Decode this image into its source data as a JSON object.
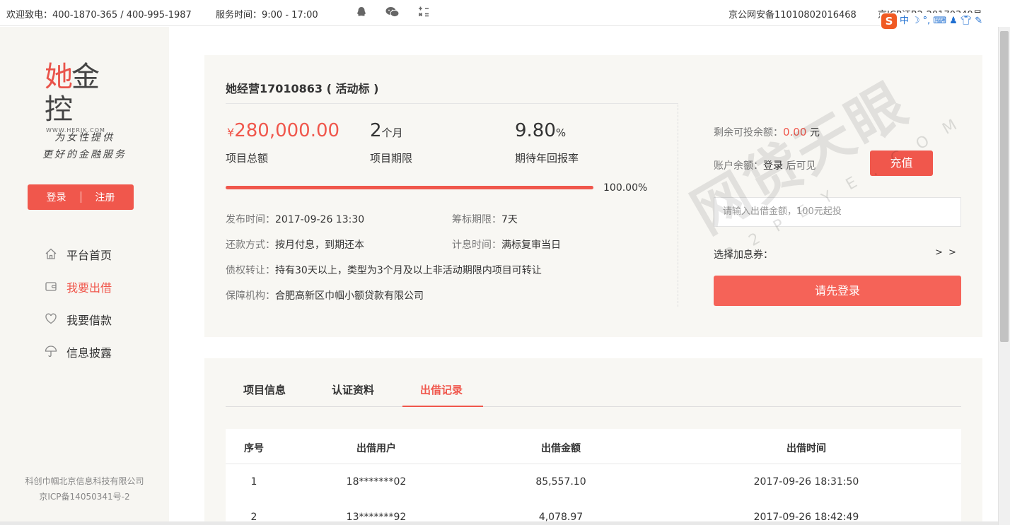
{
  "topbar": {
    "hotline": "欢迎致电：400-1870-365 / 400-995-1987",
    "service_time": "服务时间：9:00 - 17:00",
    "icons": [
      "qq-icon",
      "wechat-icon",
      "calculator-icon"
    ],
    "police_record": "京公网安备11010802016468",
    "icp": "京ICP证B2-20170349号",
    "ime": {
      "logo": "S",
      "lang": "中"
    }
  },
  "sidebar": {
    "logo_cn_red": "她",
    "logo_cn": "金控",
    "logo_url": "WWW.HERJK.COM",
    "slogan_1": "为女性提供",
    "slogan_2": "更好的金融服务",
    "login": "登录",
    "register": "注册",
    "nav": [
      {
        "label": "平台首页",
        "icon": "home-icon"
      },
      {
        "label": "我要出借",
        "icon": "wallet-icon",
        "active": true
      },
      {
        "label": "我要借款",
        "icon": "heart-icon"
      },
      {
        "label": "信息披露",
        "icon": "umbrella-icon"
      }
    ],
    "footer_1": "科创巾帼北京信息科技有限公司",
    "footer_2": "京ICP备14050341号-2"
  },
  "project": {
    "title": "她经营17010863 ( 活动标 )",
    "currency_symbol": "¥",
    "total_amount": "280,000.00",
    "total_label": "项目总额",
    "term_value": "2",
    "term_unit": "个月",
    "term_label": "项目期限",
    "rate_value": "9.80",
    "rate_unit": "%",
    "rate_label": "期待年回报率",
    "progress_percent": 100,
    "progress_text": "100.00%",
    "publish_key": "发布时间：",
    "publish_val": "2017-09-26 13:30",
    "raise_key": "筹标期限：",
    "raise_val": "7天",
    "repay_key": "还款方式：",
    "repay_val": "按月付息，到期还本",
    "interest_key": "计息时间：",
    "interest_val": "满标复审当日",
    "transfer_key": "债权转让：",
    "transfer_val": "持有30天以上，类型为3个月及以上非活动期限内项目可转让",
    "guarantee_key": "保障机构：",
    "guarantee_val": "合肥高新区巾帼小额贷款有限公司"
  },
  "invest": {
    "remaining_label": "剩余可投余额：",
    "remaining_value": "0.00",
    "remaining_unit": "元",
    "balance_label": "账户余额：",
    "balance_login": "登录",
    "balance_after": "后可见",
    "recharge": "充值",
    "amount_placeholder": "请输入出借金额，100元起投",
    "coupon_label": "选择加息券：",
    "coupon_arrow": "> >",
    "login_first": "请先登录"
  },
  "watermark": {
    "text": "网贷天眼",
    "sub": "P2PEYE.COM"
  },
  "tabs": [
    "项目信息",
    "认证资料",
    "出借记录"
  ],
  "records": {
    "headers": [
      "序号",
      "出借用户",
      "出借金额",
      "出借时间"
    ],
    "rows": [
      [
        "1",
        "18*******02",
        "85,557.10",
        "2017-09-26 18:31:50"
      ],
      [
        "2",
        "13*******92",
        "4,078.97",
        "2017-09-26 18:42:49"
      ]
    ]
  }
}
